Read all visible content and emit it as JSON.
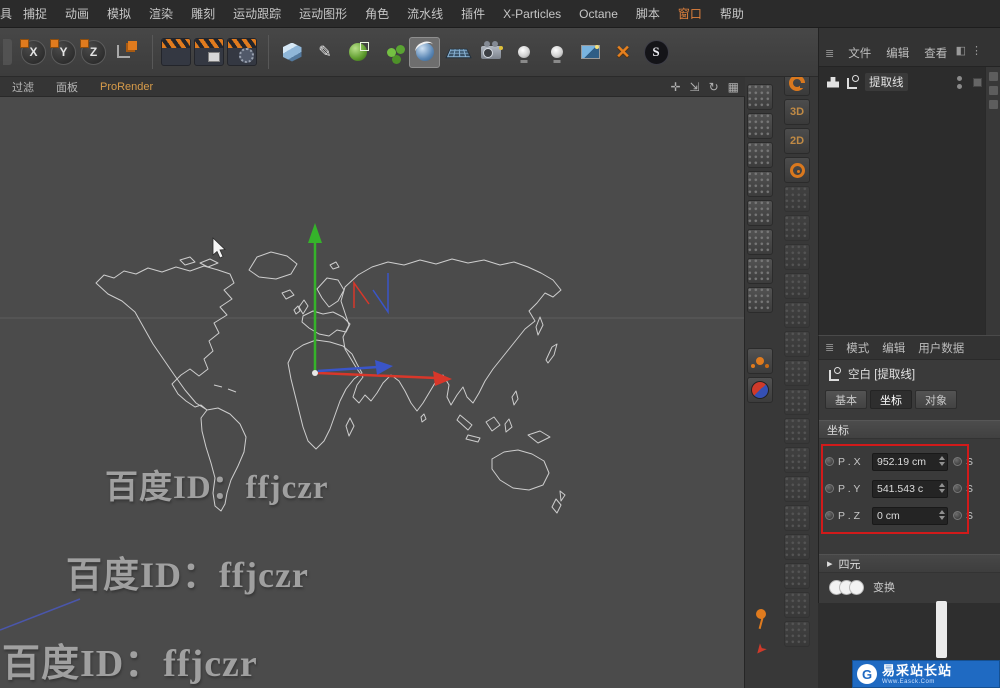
{
  "menu_bar": {
    "items": [
      "具",
      "捕捉",
      "动画",
      "模拟",
      "渲染",
      "雕刻",
      "运动跟踪",
      "运动图形",
      "角色",
      "流水线",
      "插件",
      "X-Particles",
      "Octane",
      "脚本",
      "窗口",
      "帮助"
    ]
  },
  "toolbar": {
    "axis_x": "X",
    "axis_y": "Y",
    "axis_z": "Z"
  },
  "glyphs": {
    "pen": "✎",
    "xparticles": "✕",
    "octane": "S",
    "pan": "✛",
    "zoom": "⇲",
    "rotate": "↻",
    "maximize": "▦",
    "collapse_arrow": "▸",
    "handle": "≣",
    "corner": "◧",
    "dots": "⋮",
    "red_arrow": "➤",
    "label_3d": "3D",
    "label_2d": "2D"
  },
  "viewport": {
    "tabs": [
      "过滤",
      "面板",
      "ProRender"
    ]
  },
  "object_manager": {
    "menus": [
      "文件",
      "编辑",
      "查看"
    ],
    "object_label": "提取线"
  },
  "attributes": {
    "menus": [
      "模式",
      "编辑",
      "用户数据"
    ],
    "object_title": "空白 [提取线]",
    "tabs": [
      "基本",
      "坐标",
      "对象"
    ],
    "section": "坐标",
    "rows": [
      {
        "label": "P . X",
        "value": "952.19 cm",
        "right": "S"
      },
      {
        "label": "P . Y",
        "value": "541.543 c",
        "right": "S"
      },
      {
        "label": "P . Z",
        "value": "0 cm",
        "right": "S"
      }
    ],
    "quaternion": "四元",
    "transform": "变换"
  },
  "watermark": {
    "text": "百度ID：ffjczr"
  },
  "logo": {
    "title": "易采站长站",
    "sub": "Www.Easck.Com"
  }
}
